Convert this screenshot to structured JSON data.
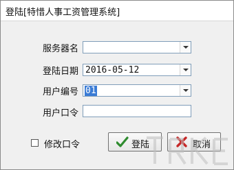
{
  "window": {
    "title": "登陆[特惜人事工资管理系统]"
  },
  "form": {
    "server_label": "服务器名",
    "server_value": "",
    "date_label": "登陆日期",
    "date_value": "2016-05-12",
    "user_id_label": "用户编号",
    "user_id_value": "01",
    "password_label": "用户口令",
    "password_value": "",
    "change_password_label": "修改口令",
    "change_password_checked": false
  },
  "buttons": {
    "login_label": "登陆",
    "cancel_label": "取消"
  },
  "icons": {
    "login": "check-icon",
    "cancel": "x-icon"
  },
  "colors": {
    "check": "#2e8b2e",
    "cancel": "#c62828",
    "selection": "#3a7bd5"
  }
}
